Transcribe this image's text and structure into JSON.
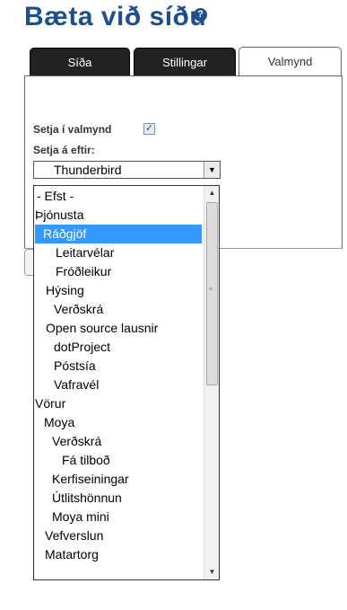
{
  "page": {
    "title": "Bæta við síðu",
    "help_icon_glyph": "?"
  },
  "tabs": [
    {
      "label": "Síða",
      "active": false
    },
    {
      "label": "Stillingar",
      "active": false
    },
    {
      "label": "Valmynd",
      "active": true
    }
  ],
  "form": {
    "menu_checkbox_label": "Setja í valmynd",
    "menu_checkbox_checked": true,
    "menu_checkbox_glyph": "✓",
    "place_after_label": "Setja á eftir:",
    "place_after_value": "Thunderbird"
  },
  "dropdown": {
    "selected_index": 2,
    "items": [
      {
        "label": "- Efst -"
      },
      {
        "label": "Þjónusta"
      },
      {
        "label": "Ráðgjöf"
      },
      {
        "label": "Leitarvélar"
      },
      {
        "label": "Fróðleikur"
      },
      {
        "label": "Hýsing"
      },
      {
        "label": "Verðskrá"
      },
      {
        "label": "Open source lausnir"
      },
      {
        "label": "dotProject"
      },
      {
        "label": "Póstsía"
      },
      {
        "label": "Vafravél"
      },
      {
        "label": "Vörur"
      },
      {
        "label": "Moya"
      },
      {
        "label": "Verðskrá"
      },
      {
        "label": "Fá tilboð"
      },
      {
        "label": "Kerfiseiningar"
      },
      {
        "label": "Útlitshönnun"
      },
      {
        "label": "Moya mini"
      },
      {
        "label": "Vefverslun"
      },
      {
        "label": "Matartorg"
      }
    ]
  },
  "scrollbar": {
    "up_glyph": "▲",
    "down_glyph": "▼",
    "grip_glyph": "≡"
  },
  "select_arrow_glyph": "▼"
}
